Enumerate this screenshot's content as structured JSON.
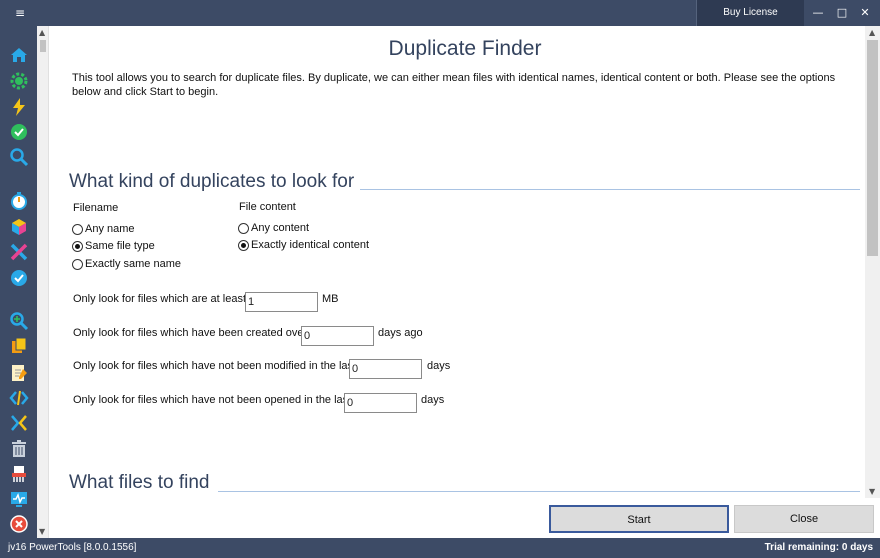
{
  "titlebar": {
    "menu_icon": "≡",
    "buy_label": "Buy License",
    "minimize": "—",
    "maximize": "□",
    "close": "✕"
  },
  "sidebar": {
    "icons": [
      "home-icon",
      "gear-check-icon",
      "bolt-icon",
      "check-circle-icon",
      "search-icon",
      "timer-icon",
      "cube-icon",
      "tools-cross-icon",
      "refresh-check-icon",
      "zoom-plus-icon",
      "duplicate-files-icon",
      "edit-note-icon",
      "code-icon",
      "split-arrows-icon",
      "trash-icon",
      "shredder-icon",
      "monitor-pulse-icon",
      "close-circle-icon"
    ]
  },
  "page": {
    "title": "Duplicate Finder",
    "intro": "This tool allows you to search for duplicate files. By duplicate, we can either mean files with identical names, identical content or both. Please see the options below and click Start to begin."
  },
  "kinds": {
    "heading": "What kind of duplicates to look for",
    "filename_label": "Filename",
    "filename_options": [
      "Any name",
      "Same file type",
      "Exactly same name"
    ],
    "filename_selected": 1,
    "content_label": "File content",
    "content_options": [
      "Any content",
      "Exactly identical content"
    ],
    "content_selected": 1
  },
  "filters": {
    "size_label": "Only look for files which are at least:",
    "size_value": "1",
    "size_unit": "MB",
    "created_label": "Only look for files which have been created over",
    "created_value": "0",
    "created_unit": "days ago",
    "modified_label": "Only look for files which have not been modified in the last",
    "modified_value": "0",
    "modified_unit": "days",
    "opened_label": "Only look for files which have not been opened in the last",
    "opened_value": "0",
    "opened_unit": "days"
  },
  "files": {
    "heading": "What files to find"
  },
  "buttons": {
    "start": "Start",
    "close": "Close"
  },
  "status": {
    "version": "jv16 PowerTools [8.0.0.1556]",
    "trial": "Trial remaining: 0 days"
  }
}
